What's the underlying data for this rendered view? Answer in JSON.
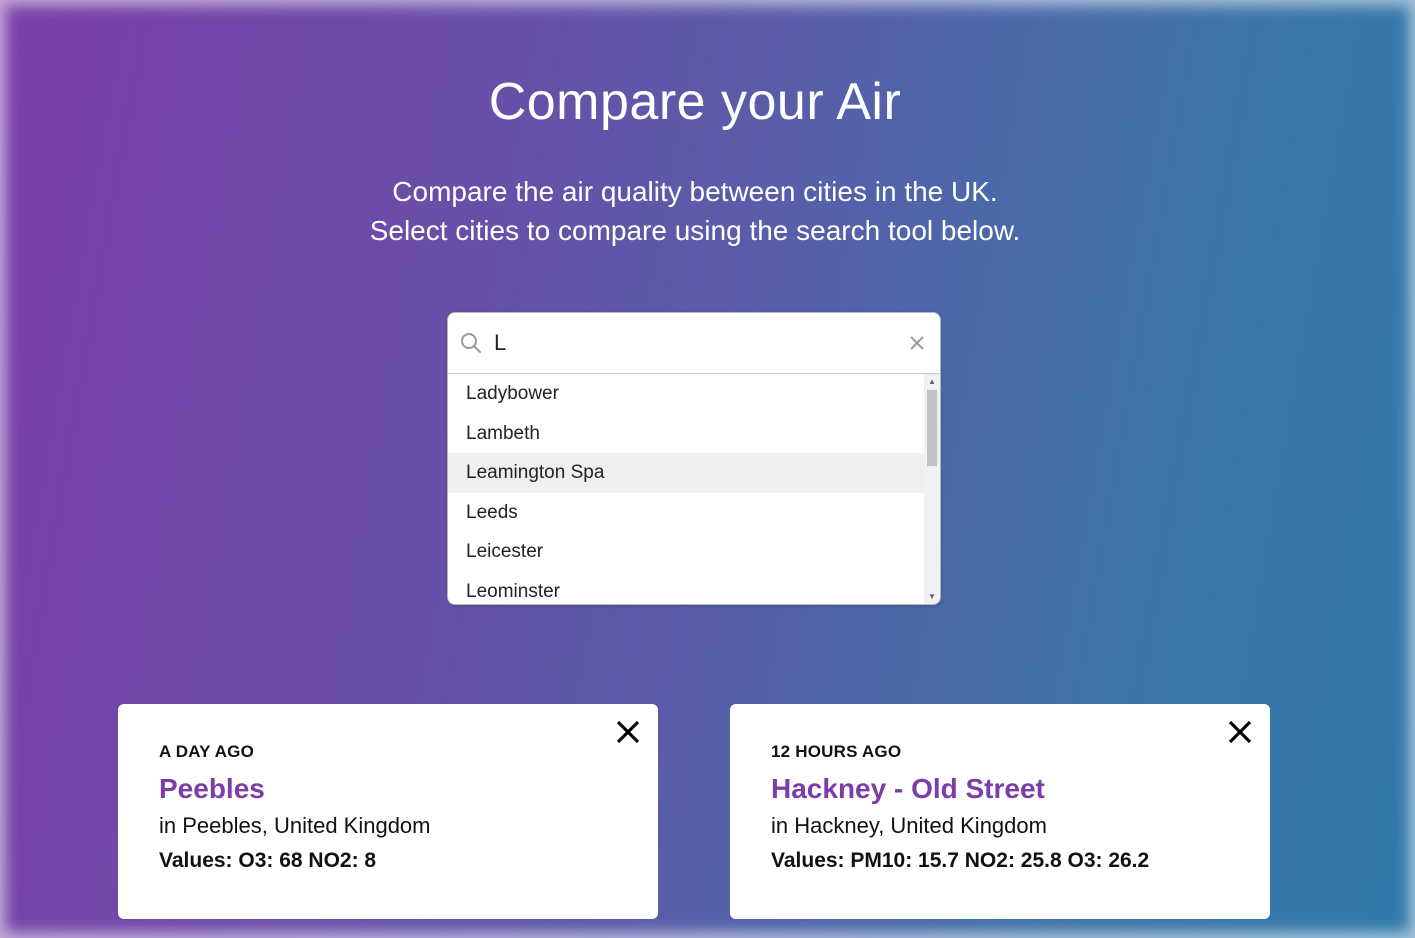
{
  "header": {
    "title": "Compare your Air",
    "subtitle_line1": "Compare the air quality between cities in the UK.",
    "subtitle_line2": "Select cities to compare using the search tool below."
  },
  "search": {
    "value": "L",
    "placeholder": "",
    "options": [
      "Ladybower",
      "Lambeth",
      "Leamington Spa",
      "Leeds",
      "Leicester",
      "Leominster"
    ],
    "highlighted_option": "Leamington Spa"
  },
  "cards": [
    {
      "ago": "A DAY AGO",
      "location": "Peebles",
      "in": "in Peebles, United Kingdom",
      "values": "Values: O3: 68 NO2: 8"
    },
    {
      "ago": "12 HOURS AGO",
      "location": "Hackney - Old Street",
      "in": "in Hackney, United Kingdom",
      "values": "Values: PM10: 15.7 NO2: 25.8 O3: 26.2"
    }
  ],
  "colors": {
    "accent": "#7b3ea8",
    "gradient_start": "#7a3ea8",
    "gradient_end": "#2f79ab"
  },
  "icons": {
    "search": "search-icon",
    "clear": "close-icon",
    "card_close": "close-icon"
  }
}
